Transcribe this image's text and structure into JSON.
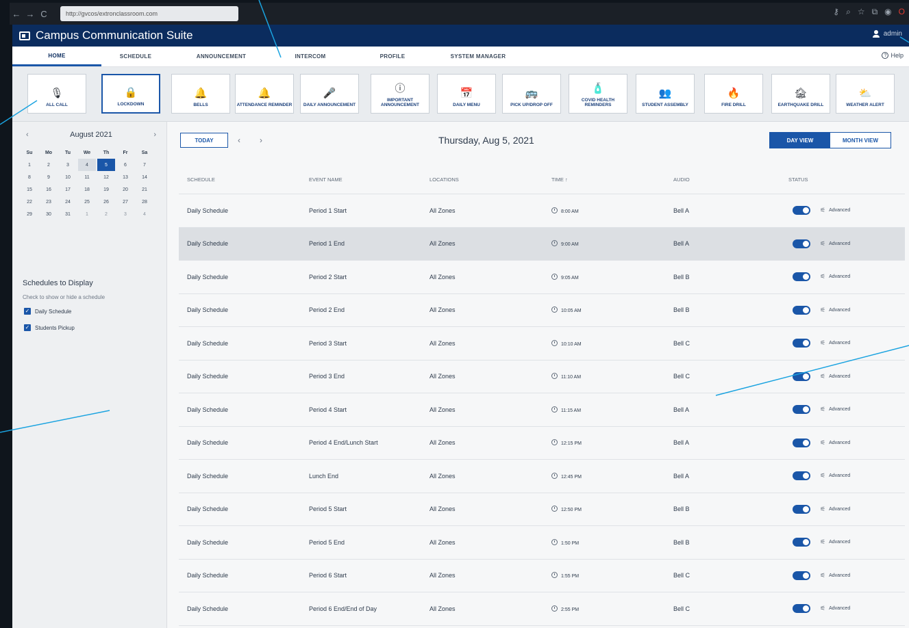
{
  "browser": {
    "url": "http://gvcos/extronclassroom.com",
    "back": "←",
    "forward": "→",
    "reload": "C",
    "icons": [
      "key-icon",
      "search-icon",
      "star-icon",
      "extension-icon",
      "account-icon",
      "opera-icon"
    ]
  },
  "app": {
    "title": "Campus Communication Suite",
    "user": "admin",
    "help": "Help"
  },
  "tabs": [
    {
      "label": "HOME"
    },
    {
      "label": "SCHEDULE"
    },
    {
      "label": "ANNOUNCEMENT"
    },
    {
      "label": "INTERCOM"
    },
    {
      "label": "PROFILE"
    },
    {
      "label": "SYSTEM MANAGER"
    }
  ],
  "alerts": [
    {
      "label": "ALL CALL",
      "icon": "🎙"
    },
    {
      "label": "LOCKDOWN",
      "icon": "🔒"
    },
    {
      "label": "BELLS",
      "icon": "🔔"
    },
    {
      "label": "ATTENDANCE REMINDER",
      "icon": "🔔"
    },
    {
      "label": "DAILY ANNOUNCEMENT",
      "icon": "🎤"
    },
    {
      "label": "IMPORTANT ANNOUNCEMENT",
      "icon": "ⓘ"
    },
    {
      "label": "DAILY MENU",
      "icon": "📅"
    },
    {
      "label": "PICK UP/DROP OFF",
      "icon": "🚌"
    },
    {
      "label": "COVID HEALTH REMINDERS",
      "icon": "🧴"
    },
    {
      "label": "STUDENT ASSEMBLY",
      "icon": "👥"
    },
    {
      "label": "FIRE DRILL",
      "icon": "🔥"
    },
    {
      "label": "EARTHQUAKE DRILL",
      "icon": "🏚"
    },
    {
      "label": "WEATHER ALERT",
      "icon": "⛅"
    }
  ],
  "calendar": {
    "month": "August 2021",
    "prev": "‹",
    "next": "›",
    "dow": [
      "Su",
      "Mo",
      "Tu",
      "We",
      "Th",
      "Fr",
      "Sa"
    ],
    "weeks": [
      [
        "1",
        "2",
        "3",
        "4",
        "5",
        "6",
        "7"
      ],
      [
        "8",
        "9",
        "10",
        "11",
        "12",
        "13",
        "14"
      ],
      [
        "15",
        "16",
        "17",
        "18",
        "19",
        "20",
        "21"
      ],
      [
        "22",
        "23",
        "24",
        "25",
        "26",
        "27",
        "28"
      ],
      [
        "29",
        "30",
        "31",
        "1",
        "2",
        "3",
        "4"
      ]
    ],
    "highlighted": "4",
    "selected": "5"
  },
  "schedules_panel": {
    "title": "Schedules to Display",
    "subtitle": "Check to show or hide a schedule",
    "items": [
      {
        "label": "Daily Schedule",
        "checked": true
      },
      {
        "label": "Students Pickup",
        "checked": true
      }
    ]
  },
  "toolbar": {
    "today": "TODAY",
    "prev": "‹",
    "next": "›",
    "date": "Thursday, Aug 5, 2021",
    "day_view": "DAY VIEW",
    "month_view": "MONTH VIEW"
  },
  "table": {
    "headers": {
      "schedule": "SCHEDULE",
      "event": "EVENT NAME",
      "locations": "LOCATIONS",
      "time": "TIME ↑",
      "audio": "AUDIO",
      "status": "STATUS"
    },
    "advanced_label": "Advanced",
    "rows": [
      {
        "schedule": "Daily Schedule",
        "event": "Period 1 Start",
        "location": "All Zones",
        "time": "8:00 AM",
        "audio": "Bell A"
      },
      {
        "schedule": "Daily Schedule",
        "event": "Period 1 End",
        "location": "All Zones",
        "time": "9:00 AM",
        "audio": "Bell A"
      },
      {
        "schedule": "Daily Schedule",
        "event": "Period 2 Start",
        "location": "All Zones",
        "time": "9:05 AM",
        "audio": "Bell B"
      },
      {
        "schedule": "Daily Schedule",
        "event": "Period 2 End",
        "location": "All Zones",
        "time": "10:05 AM",
        "audio": "Bell B"
      },
      {
        "schedule": "Daily Schedule",
        "event": "Period 3 Start",
        "location": "All Zones",
        "time": "10:10 AM",
        "audio": "Bell C"
      },
      {
        "schedule": "Daily Schedule",
        "event": "Period 3 End",
        "location": "All Zones",
        "time": "11:10 AM",
        "audio": "Bell C"
      },
      {
        "schedule": "Daily Schedule",
        "event": "Period 4 Start",
        "location": "All Zones",
        "time": "11:15 AM",
        "audio": "Bell A"
      },
      {
        "schedule": "Daily Schedule",
        "event": "Period 4 End/Lunch Start",
        "location": "All Zones",
        "time": "12:15 PM",
        "audio": "Bell A"
      },
      {
        "schedule": "Daily Schedule",
        "event": "Lunch End",
        "location": "All Zones",
        "time": "12:45 PM",
        "audio": "Bell A"
      },
      {
        "schedule": "Daily Schedule",
        "event": "Period 5 Start",
        "location": "All Zones",
        "time": "12:50 PM",
        "audio": "Bell B"
      },
      {
        "schedule": "Daily Schedule",
        "event": "Period 5 End",
        "location": "All Zones",
        "time": "1:50 PM",
        "audio": "Bell B"
      },
      {
        "schedule": "Daily Schedule",
        "event": "Period 6 Start",
        "location": "All Zones",
        "time": "1:55 PM",
        "audio": "Bell C"
      },
      {
        "schedule": "Daily Schedule",
        "event": "Period 6 End/End of Day",
        "location": "All Zones",
        "time": "2:55 PM",
        "audio": "Bell C"
      }
    ],
    "shaded_row": 1
  },
  "colors": {
    "brand_header": "#0b2c5e",
    "accent": "#1a56a8",
    "callout": "#1aa3e0"
  }
}
